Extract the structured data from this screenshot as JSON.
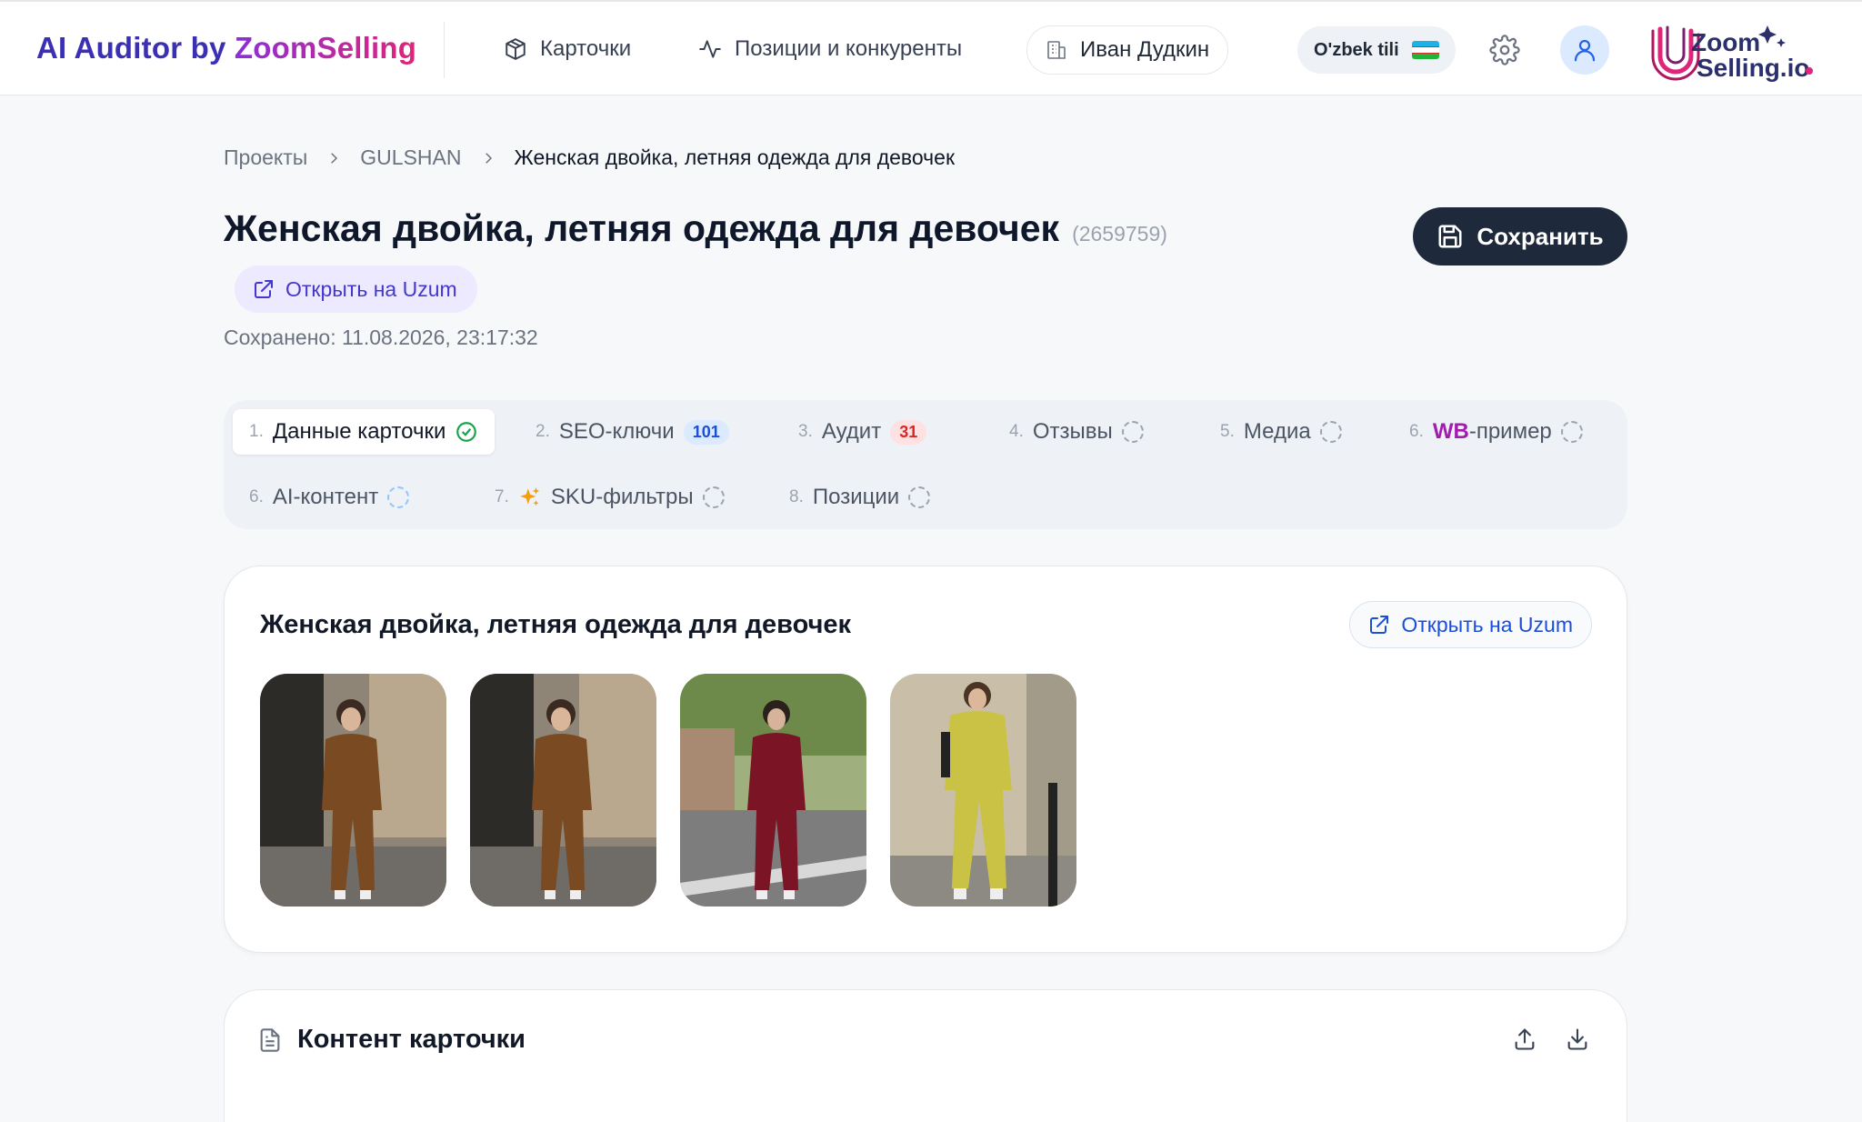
{
  "header": {
    "brand_part1": "AI Auditor by ",
    "brand_part2": "ZoomSelling",
    "nav_cards": "Карточки",
    "nav_positions": "Позиции и конкуренты",
    "user_name": "Иван Дудкин",
    "language": "O'zbek tili",
    "logo_text_1": "Zoom",
    "logo_text_2": "Selling.io",
    "icons": [
      "box-icon",
      "activity-icon",
      "building-icon",
      "flag-uz-icon",
      "gear-icon",
      "user-icon"
    ]
  },
  "breadcrumb": {
    "items": [
      "Проекты",
      "GULSHAN",
      "Женская двойка, летняя одежда для девочек"
    ]
  },
  "product": {
    "title": "Женская двойка, летняя одежда для девочек",
    "sku": "(2659759)",
    "open_label": "Открыть на Uzum",
    "saved_text": "Сохранено: 11.08.2026, 23:17:32",
    "save_label": "Сохранить"
  },
  "tabs": [
    {
      "num": "1.",
      "label": "Данные карточки",
      "status": "done",
      "active": true
    },
    {
      "num": "2.",
      "label": "SEO-ключи",
      "badge": "101",
      "badge_color": "blue"
    },
    {
      "num": "3.",
      "label": "Аудит",
      "badge": "31",
      "badge_color": "red"
    },
    {
      "num": "4.",
      "label": "Отзывы",
      "status": "pending"
    },
    {
      "num": "5.",
      "label": "Медиа",
      "status": "pending"
    },
    {
      "num": "6.",
      "label_prefix": "WB",
      "label": "-пример",
      "status": "pending"
    },
    {
      "num": "6.",
      "label": "AI-контент",
      "status": "pending"
    },
    {
      "num": "7.",
      "label": "SKU-фильтры",
      "status": "pending",
      "icon": "sparkle-icon"
    },
    {
      "num": "8.",
      "label": "Позиции",
      "status": "pending"
    }
  ],
  "card": {
    "title": "Женская двойка, летняя одежда для девочек",
    "open_label": "Открыть на Uzum",
    "photos": [
      {
        "outfit_color": "#7a4a22"
      },
      {
        "outfit_color": "#7a4a22"
      },
      {
        "outfit_color": "#7b1424"
      },
      {
        "outfit_color": "#c9c244"
      }
    ]
  },
  "content": {
    "title": "Контент карточки"
  },
  "colors": {
    "accent": "#1e293b",
    "brand_blue": "#3b2fb3",
    "brand_pink": "#e0247a",
    "badge_blue": "#1d4ed8",
    "badge_red": "#dc2626",
    "success": "#16a34a"
  }
}
